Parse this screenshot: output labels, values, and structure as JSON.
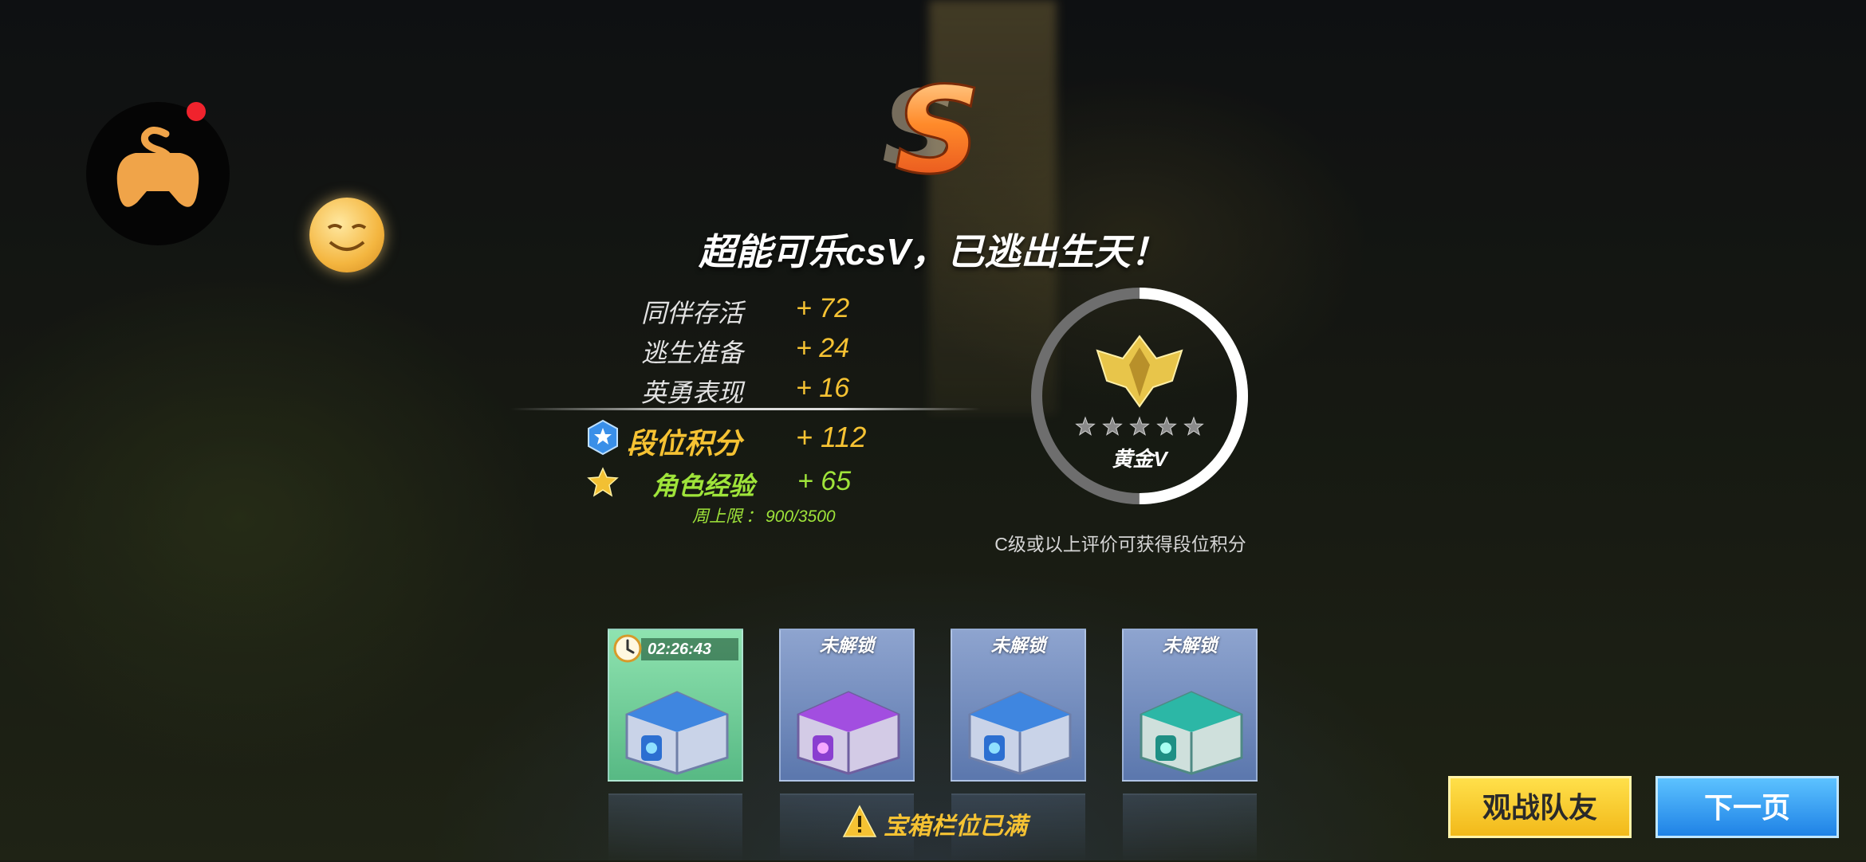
{
  "result": {
    "grade": "S",
    "headline": "超能可乐csV，已逃出生天！"
  },
  "score_rows": [
    {
      "label": "同伴存活",
      "value": "+ 72"
    },
    {
      "label": "逃生准备",
      "value": "+ 24"
    },
    {
      "label": "英勇表现",
      "value": "+ 16"
    }
  ],
  "rank_points": {
    "label": "段位积分",
    "value": "+ 112"
  },
  "character_exp": {
    "label": "角色经验",
    "value": "+ 65"
  },
  "weekly_cap": {
    "label": "周上限",
    "separator": "：",
    "value": "900/3500"
  },
  "rank": {
    "tier": "黄金V",
    "stars_total": 5,
    "stars_filled": 0,
    "progress_fraction": 0.5,
    "note": "C级或以上评价可获得段位积分"
  },
  "chests": [
    {
      "status": "timer",
      "timer": "02:26:43",
      "color": "blue"
    },
    {
      "status": "locked",
      "label": "未解锁",
      "color": "purple"
    },
    {
      "status": "locked",
      "label": "未解锁",
      "color": "blue"
    },
    {
      "status": "locked",
      "label": "未解锁",
      "color": "teal"
    }
  ],
  "chest_warning": "宝箱栏位已满",
  "buttons": {
    "spectate": "观战队友",
    "next_page": "下一页"
  },
  "colors": {
    "gold": "#f5c233",
    "green": "#9fe43a",
    "spectate_button": "#f2c51f",
    "next_button": "#2f95f0"
  }
}
